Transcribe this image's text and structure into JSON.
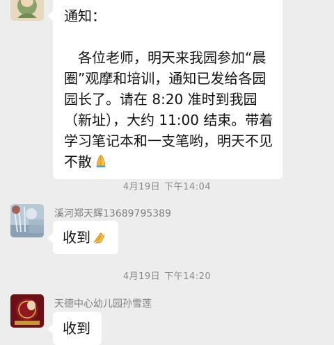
{
  "messages": [
    {
      "type": "text",
      "lines": [
        "通知：",
        "",
        "各位老师，明天来我园参加“晨",
        "圈”观摩和培训，通知已发给各园",
        "园长了。请在 8:20 准时到我园",
        "（新址），大约 11:00 结束。带着",
        "学习笔记本和一支笔哟，明天不见",
        "不散"
      ],
      "emoji": "folded-hands"
    },
    {
      "type": "timestamp",
      "date": "4月19日",
      "time": "下午14:04"
    },
    {
      "type": "text",
      "sender": "溪河郑天辉13689795389",
      "text": "收到",
      "emoji": "folded-hands"
    },
    {
      "type": "timestamp",
      "date": "4月19日",
      "time": "下午14:20"
    },
    {
      "type": "text",
      "sender": "天德中心幼儿园孙雪莲",
      "text": "收到"
    }
  ],
  "colors": {
    "background": "#ededed",
    "bubble": "#ffffff",
    "meta_text": "#8a8a8a",
    "emoji": "#f2b233"
  }
}
